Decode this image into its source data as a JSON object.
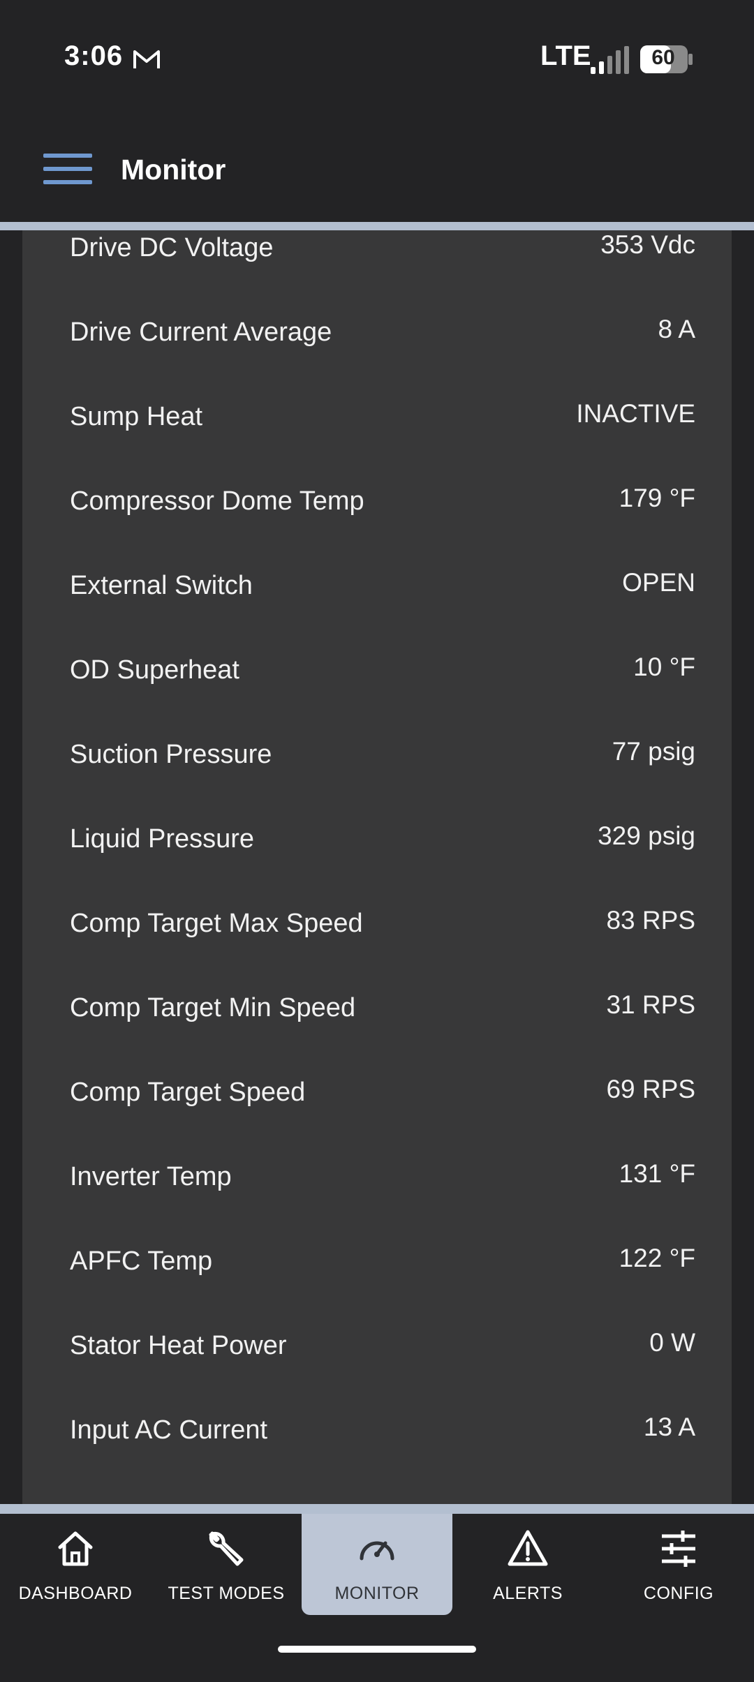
{
  "status_bar": {
    "time": "3:06",
    "network": "LTE",
    "battery": "60"
  },
  "app_bar": {
    "title": "Monitor",
    "menu_icon": "hamburger-menu-icon"
  },
  "monitor": {
    "rows": [
      {
        "label": "Drive DC Voltage",
        "value": "353 Vdc"
      },
      {
        "label": "Drive Current Average",
        "value": "8 A"
      },
      {
        "label": "Sump Heat",
        "value": "INACTIVE"
      },
      {
        "label": "Compressor Dome Temp",
        "value": "179 °F"
      },
      {
        "label": "External Switch",
        "value": "OPEN"
      },
      {
        "label": "OD Superheat",
        "value": "10 °F"
      },
      {
        "label": "Suction Pressure",
        "value": "77 psig"
      },
      {
        "label": "Liquid Pressure",
        "value": "329 psig"
      },
      {
        "label": "Comp Target Max Speed",
        "value": "83 RPS"
      },
      {
        "label": "Comp Target Min Speed",
        "value": "31 RPS"
      },
      {
        "label": "Comp Target Speed",
        "value": "69 RPS"
      },
      {
        "label": "Inverter Temp",
        "value": "131 °F"
      },
      {
        "label": "APFC Temp",
        "value": "122 °F"
      },
      {
        "label": "Stator Heat Power",
        "value": "0 W"
      },
      {
        "label": "Input AC Current",
        "value": "13 A"
      }
    ]
  },
  "bottom_nav": {
    "items": [
      {
        "label": "DASHBOARD",
        "icon": "home-icon"
      },
      {
        "label": "TEST MODES",
        "icon": "wrench-icon"
      },
      {
        "label": "MONITOR",
        "icon": "gauge-icon"
      },
      {
        "label": "ALERTS",
        "icon": "warning-icon"
      },
      {
        "label": "CONFIG",
        "icon": "sliders-icon"
      }
    ],
    "active": "MONITOR"
  },
  "colors": {
    "background": "#232325",
    "card": "#383839",
    "accent": "#6f98cf",
    "divider": "#b3bfd0",
    "active_tab": "#bdc6d6"
  }
}
